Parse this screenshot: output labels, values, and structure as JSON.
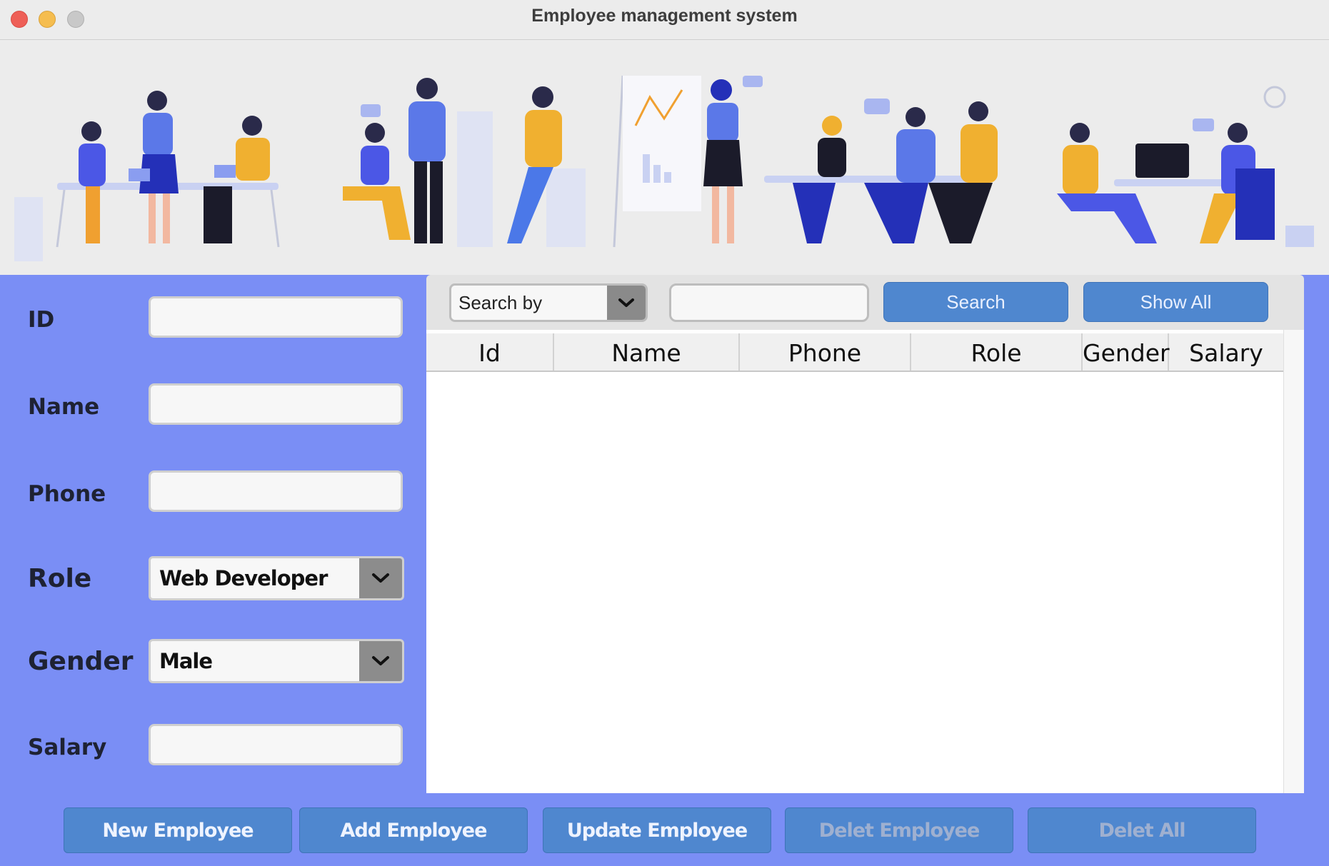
{
  "window": {
    "title": "Employee management system"
  },
  "form": {
    "id_label": "ID",
    "name_label": "Name",
    "phone_label": "Phone",
    "role_label": "Role",
    "role_value": "Web Developer",
    "gender_label": "Gender",
    "gender_value": "Male",
    "salary_label": "Salary",
    "id_value": "",
    "name_value": "",
    "phone_value": "",
    "salary_value": ""
  },
  "search": {
    "search_by_value": "Search by",
    "query": "",
    "search_label": "Search",
    "show_all_label": "Show All"
  },
  "table": {
    "columns": [
      "Id",
      "Name",
      "Phone",
      "Role",
      "Gender",
      "Salary"
    ],
    "rows": []
  },
  "actions": {
    "new_employee": "New Employee",
    "add_employee": "Add Employee",
    "update_employee": "Update Employee",
    "delete_employee": "Delet Employee",
    "delete_all": "Delet All"
  },
  "colors": {
    "panel_blue": "#7a8ef5",
    "button_blue": "#4f87cf",
    "banner_bg": "#ececec"
  }
}
